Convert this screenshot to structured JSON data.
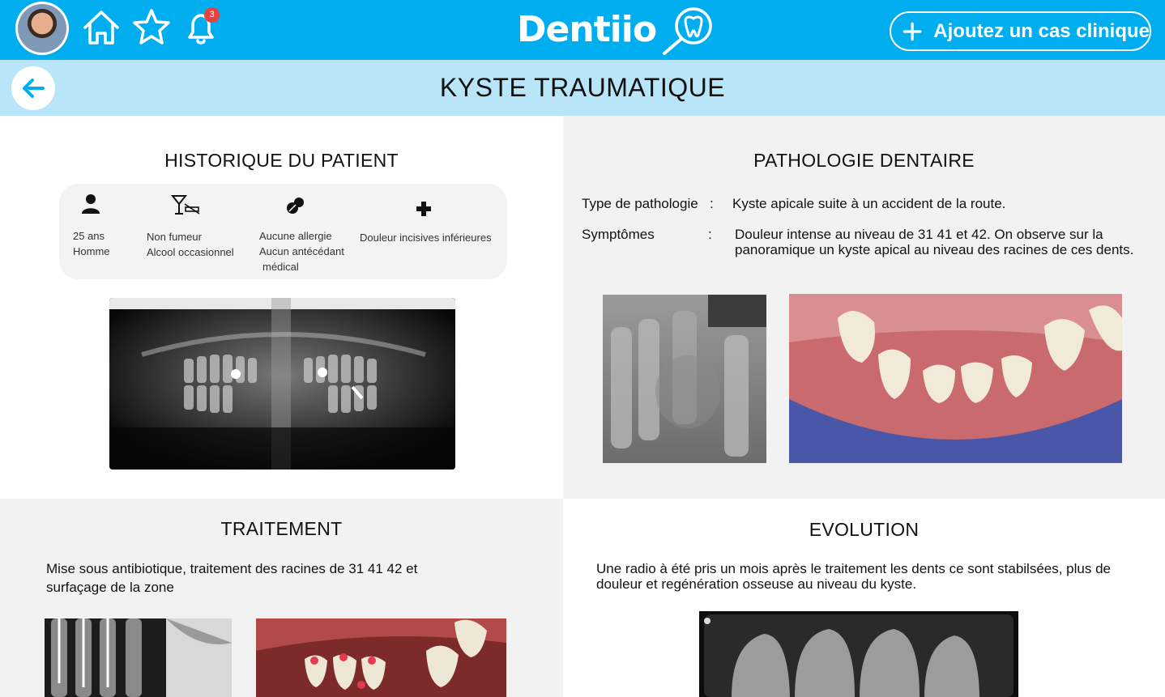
{
  "header": {
    "logo_text": "Dentiio",
    "notification_count": "3",
    "add_case_label": "Ajoutez un cas clinique",
    "brand_color": "#00aeef"
  },
  "page": {
    "title": "KYSTE TRAUMATIQUE"
  },
  "history": {
    "title": "HISTORIQUE DU PATIENT",
    "items": [
      {
        "icon": "person-icon",
        "lines": [
          "25 ans",
          "Homme"
        ]
      },
      {
        "icon": "no-smoking-cocktail-icon",
        "lines": [
          "Non fumeur",
          "Alcool occasionnel"
        ]
      },
      {
        "icon": "pills-icon",
        "lines": [
          "Aucune allergie",
          "Aucun antécédant",
          "médical"
        ]
      },
      {
        "icon": "medical-cross-icon",
        "lines": [
          "Douleur incisives inférieures"
        ]
      }
    ]
  },
  "pathology": {
    "title": "PATHOLOGIE DENTAIRE",
    "type_label": "Type de pathologie",
    "type_sep": ":",
    "type_value": "Kyste apicale suite à un accident de la route.",
    "symptoms_label": "Symptômes",
    "symptoms_sep": ":",
    "symptoms_value_line1": "Douleur intense au niveau de 31 41 et 42. On observe sur la",
    "symptoms_value_line2": "panoramique un kyste apical au niveau des racines de ces dents."
  },
  "treatment": {
    "title": "TRAITEMENT",
    "text_line1": "Mise sous antibiotique, traitement des racines de 31 41 42 et",
    "text_line2": "surfaçage de la zone"
  },
  "evolution": {
    "title": "EVOLUTION",
    "text_line1": "Une radio à été pris un mois après le traitement les dents ce sont stabilsées, plus de",
    "text_line2": "douleur et regénération osseuse au niveau du kyste."
  }
}
